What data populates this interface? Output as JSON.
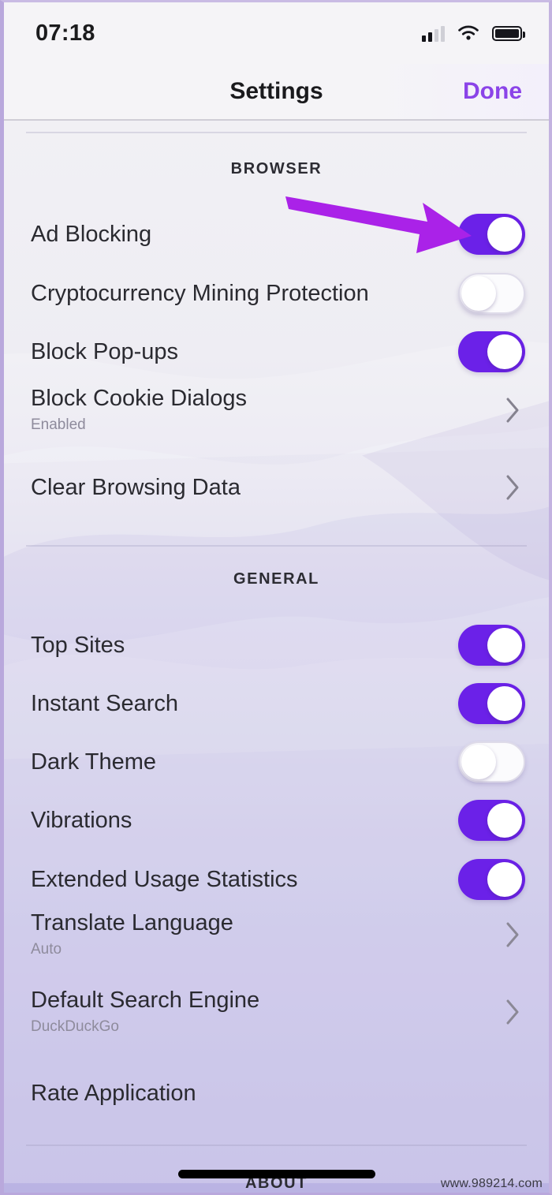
{
  "status_bar": {
    "time": "07:18",
    "signal_icon": "cellular-signal-icon",
    "signal_bars_filled": 2,
    "signal_bars_total": 4,
    "wifi_icon": "wifi-icon",
    "battery_icon": "battery-full-icon",
    "battery_level_pct": 100
  },
  "nav": {
    "title": "Settings",
    "done_label": "Done",
    "done_color": "#8b44e8"
  },
  "colors": {
    "toggle_on": "#6b21e8",
    "toggle_off": "#fbfbfd",
    "accent": "#8b44e8",
    "arrow": "#aa22e8",
    "background_top": "#f1f0f4",
    "background_bottom": "#bab3e3",
    "subtitle_text": "#8e8b9c",
    "title_text": "#2a2a30"
  },
  "sections": [
    {
      "header": "BROWSER",
      "rows": [
        {
          "title": "Ad Blocking",
          "subtitle": "",
          "control": "toggle",
          "value": "on"
        },
        {
          "title": "Cryptocurrency Mining Protection",
          "subtitle": "",
          "control": "toggle",
          "value": "off"
        },
        {
          "title": "Block Pop-ups",
          "subtitle": "",
          "control": "toggle",
          "value": "on"
        },
        {
          "title": "Block Cookie Dialogs",
          "subtitle": "Enabled",
          "control": "chevron",
          "value": ""
        },
        {
          "title": "Clear Browsing Data",
          "subtitle": "",
          "control": "chevron",
          "value": ""
        }
      ]
    },
    {
      "header": "GENERAL",
      "rows": [
        {
          "title": "Top Sites",
          "subtitle": "",
          "control": "toggle",
          "value": "on"
        },
        {
          "title": "Instant Search",
          "subtitle": "",
          "control": "toggle",
          "value": "on"
        },
        {
          "title": "Dark Theme",
          "subtitle": "",
          "control": "toggle",
          "value": "off"
        },
        {
          "title": "Vibrations",
          "subtitle": "",
          "control": "toggle",
          "value": "on"
        },
        {
          "title": "Extended Usage Statistics",
          "subtitle": "",
          "control": "toggle",
          "value": "on"
        },
        {
          "title": "Translate Language",
          "subtitle": "Auto",
          "control": "chevron",
          "value": ""
        },
        {
          "title": "Default Search Engine",
          "subtitle": "DuckDuckGo",
          "control": "chevron",
          "value": ""
        },
        {
          "title": "Rate Application",
          "subtitle": "",
          "control": "none",
          "value": ""
        }
      ]
    },
    {
      "header": "ABOUT",
      "rows": []
    }
  ],
  "annotation": {
    "arrow_icon": "arrow-right-annotation",
    "points_to": "Ad Blocking toggle"
  },
  "watermark": "www.989214.com"
}
